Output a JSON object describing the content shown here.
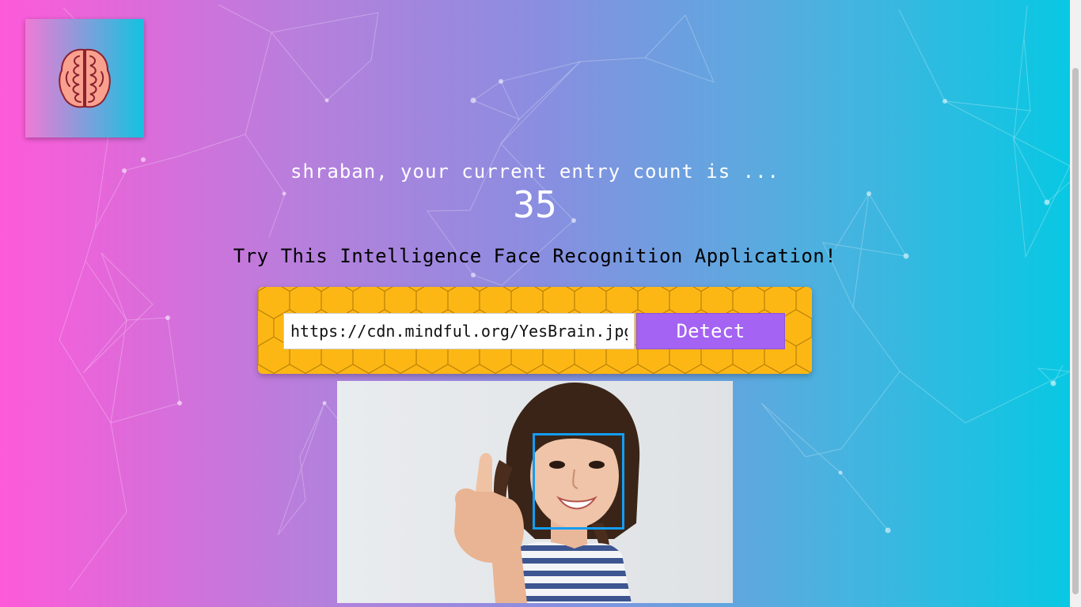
{
  "app": {
    "logo_icon": "brain-icon",
    "accent_color": "#a463f2",
    "panel_color": "#fdb714"
  },
  "rank": {
    "greeting": "shraban, your current entry count is ...",
    "count": "35"
  },
  "tagline": "Try This Intelligence Face Recognition Application!",
  "form": {
    "url_value": "https://cdn.mindful.org/YesBrain.jpg",
    "detect_label": "Detect"
  },
  "result": {
    "faces_detected": 1,
    "box_color": "#149df2"
  }
}
